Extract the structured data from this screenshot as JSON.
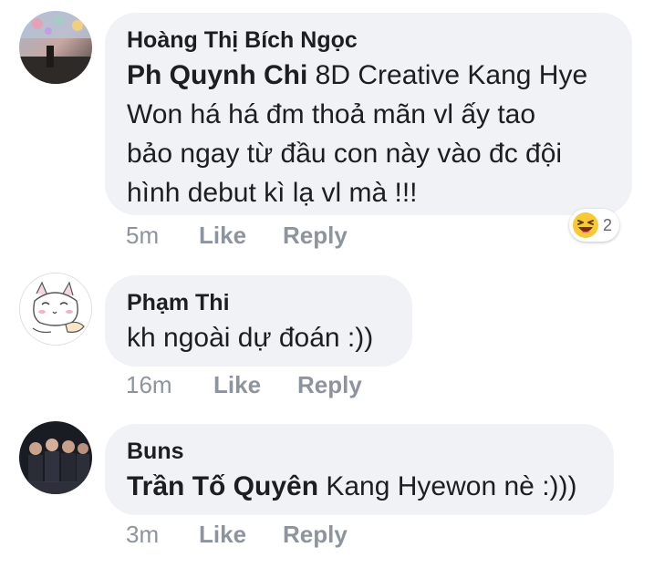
{
  "comments": [
    {
      "author": "Hoàng Thị Bích Ngọc",
      "mention": "Ph Quynh Chi",
      "text_lines": [
        " 8D Creative Kang Hye",
        "Won há há đm thoả mãn vl ấy tao",
        "bảo ngay từ đầu con này vào đc đội",
        "hình debut kì lạ vl mà !!!"
      ],
      "time": "5m",
      "like_label": "Like",
      "reply_label": "Reply",
      "reaction_icon": "laughing-emoji-icon",
      "reaction_count": "2"
    },
    {
      "author": "Phạm Thi",
      "text": "kh ngoài dự đoán :))",
      "time": "16m",
      "like_label": "Like",
      "reply_label": "Reply"
    },
    {
      "author": "Buns",
      "mention": "Trần Tố Quyên",
      "text": " Kang Hyewon nè :)))",
      "time": "3m",
      "like_label": "Like",
      "reply_label": "Reply"
    }
  ],
  "colors": {
    "bubble": "#f0f2f5",
    "meta_text": "#8d949e",
    "text": "#1c1e21"
  }
}
